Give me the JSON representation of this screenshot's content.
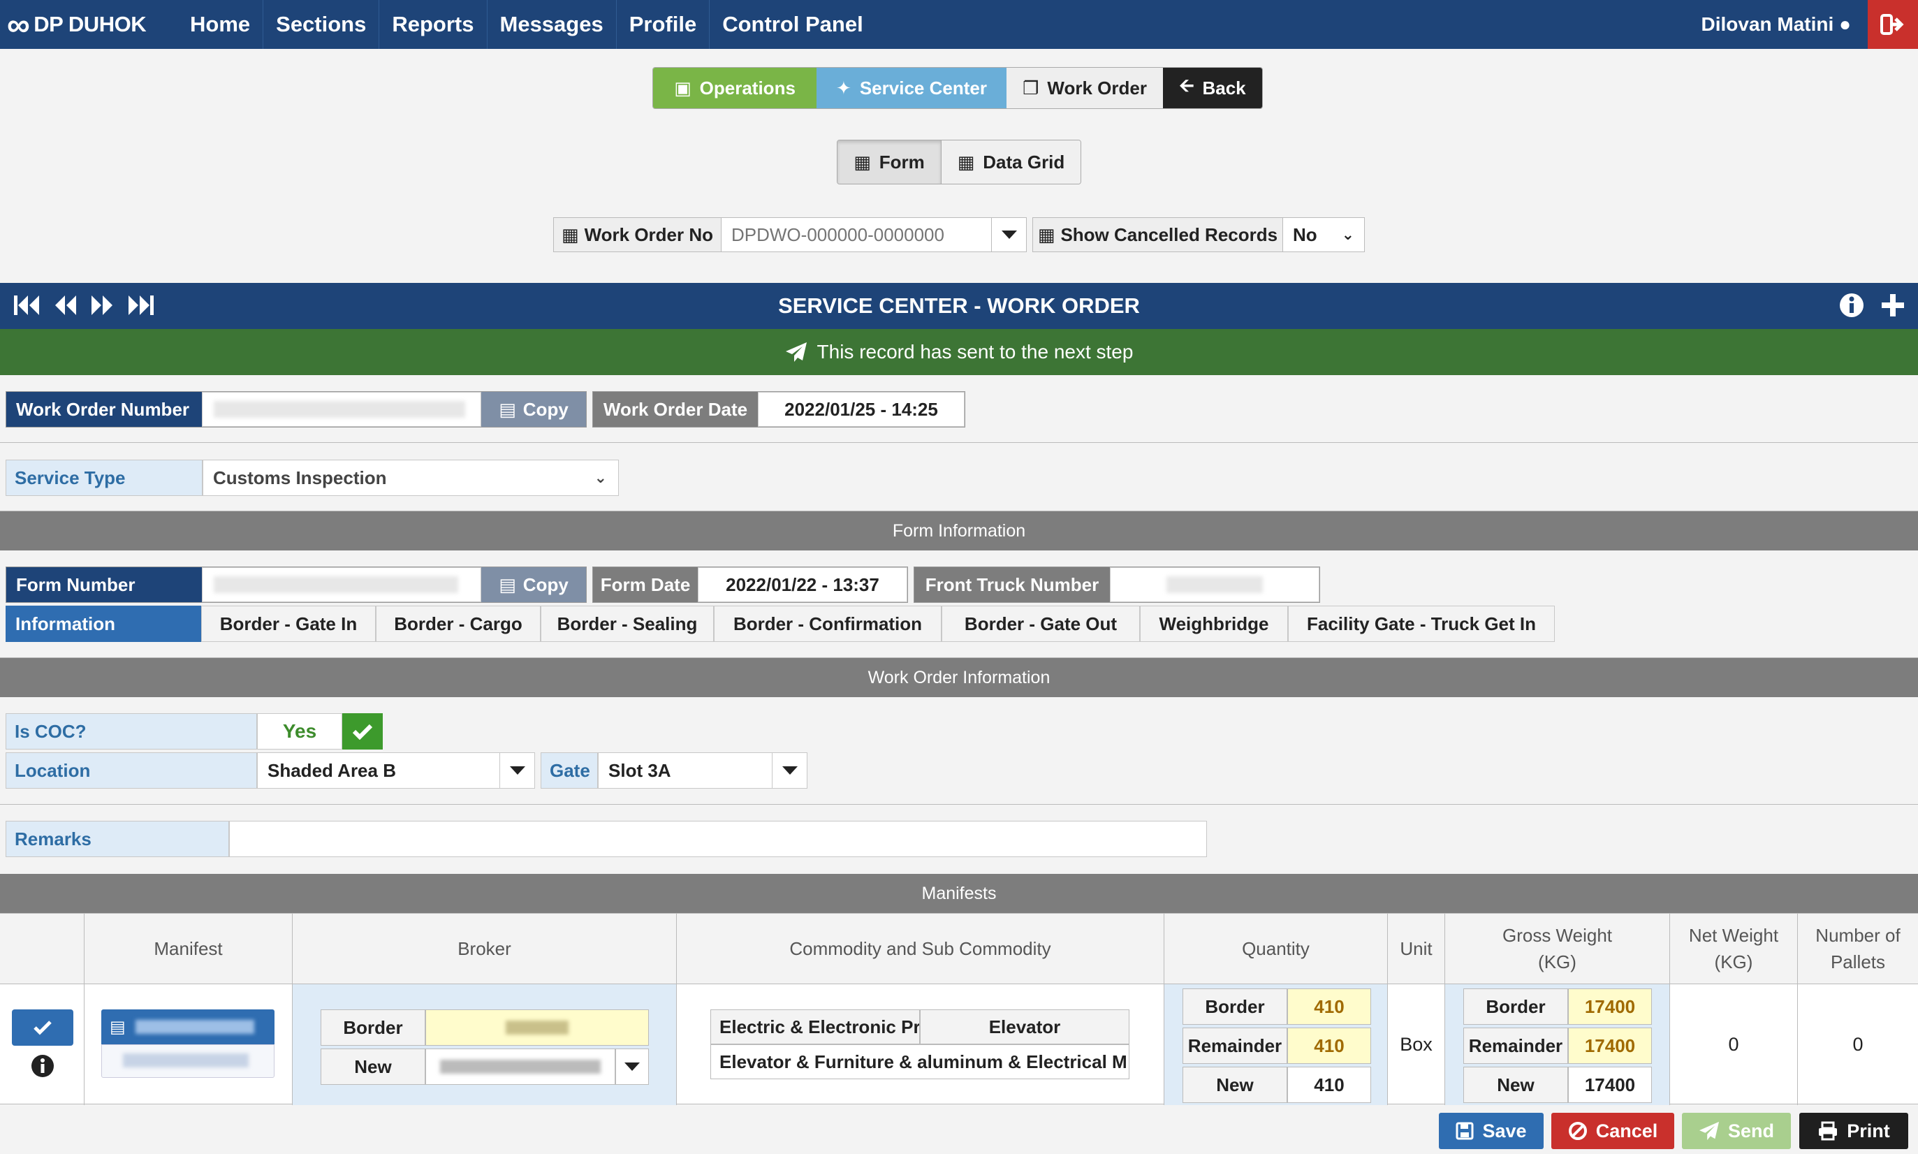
{
  "nav": {
    "logo": "DP DUHOK",
    "menu": [
      "Home",
      "Sections",
      "Reports",
      "Messages",
      "Profile",
      "Control Panel"
    ],
    "user": "Dilovan Matini"
  },
  "toolbar": {
    "operations": "Operations",
    "service_center": "Service Center",
    "work_order": "Work Order",
    "back": "Back"
  },
  "view_toggle": {
    "form": "Form",
    "data_grid": "Data Grid"
  },
  "filter": {
    "work_order_no_label": "Work Order No",
    "work_order_no_placeholder": "DPDWO-000000-0000000",
    "show_cancelled_label": "Show Cancelled Records",
    "show_cancelled_value": "No"
  },
  "header": {
    "title": "SERVICE CENTER - WORK ORDER"
  },
  "status": {
    "message": "This record has sent to the next step"
  },
  "work_order": {
    "number_label": "Work Order Number",
    "copy": "Copy",
    "date_label": "Work Order Date",
    "date_value": "2022/01/25 - 14:25"
  },
  "service_type": {
    "label": "Service Type",
    "value": "Customs Inspection"
  },
  "form_info": {
    "section": "Form Information",
    "form_number_label": "Form Number",
    "copy": "Copy",
    "form_date_label": "Form Date",
    "form_date_value": "2022/01/22 - 13:37",
    "front_truck_label": "Front Truck Number",
    "tabs": [
      "Information",
      "Border - Gate In",
      "Border - Cargo",
      "Border - Sealing",
      "Border - Confirmation",
      "Border - Gate Out",
      "Weighbridge",
      "Facility Gate - Truck Get In"
    ]
  },
  "wo_info": {
    "section": "Work Order Information",
    "is_coc_label": "Is COC?",
    "is_coc_value": "Yes",
    "location_label": "Location",
    "location_value": "Shaded Area B",
    "gate_label": "Gate",
    "gate_value": "Slot 3A",
    "remarks_label": "Remarks"
  },
  "manifests": {
    "section": "Manifests",
    "columns": {
      "manifest": "Manifest",
      "broker": "Broker",
      "commodity": "Commodity and Sub Commodity",
      "quantity": "Quantity",
      "unit": "Unit",
      "gross": "Gross Weight (KG)",
      "net": "Net Weight (KG)",
      "pallets": "Number of Pallets"
    },
    "row": {
      "broker_border_label": "Border",
      "broker_new_label": "New",
      "commodity_1": "Electric & Electronic Pr",
      "sub_commodity_1": "Elevator",
      "commodity_2": "Elevator & Furniture & aluminum & Electrical M",
      "qty_border_label": "Border",
      "qty_border": "410",
      "qty_remainder_label": "Remainder",
      "qty_remainder": "410",
      "qty_new_label": "New",
      "qty_new": "410",
      "unit": "Box",
      "gw_border_label": "Border",
      "gw_border": "17400",
      "gw_remainder_label": "Remainder",
      "gw_remainder": "17400",
      "gw_new_label": "New",
      "gw_new": "17400",
      "net": "0",
      "pallets": "0"
    }
  },
  "actions": {
    "save": "Save",
    "cancel": "Cancel",
    "send": "Send",
    "print": "Print"
  },
  "colors": {
    "navy": "#1e4478",
    "green": "#3d7535",
    "ops_green": "#7ab547",
    "sc_blue": "#6aaed8",
    "danger": "#c9302c"
  }
}
